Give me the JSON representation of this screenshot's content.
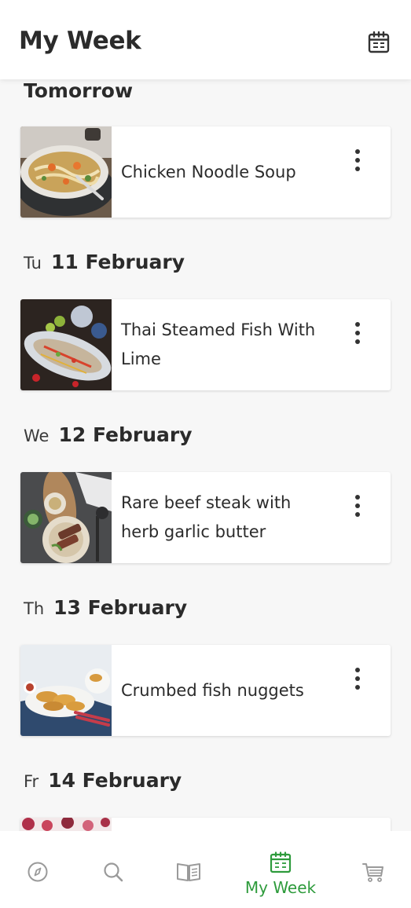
{
  "app_bar": {
    "title": "My Week",
    "calendar_icon": "calendar-icon"
  },
  "sections": [
    {
      "day": "",
      "date": "Tomorrow",
      "recipe": {
        "title": "Chicken Noodle Soup",
        "image": "chicken-noodle-soup-photo"
      }
    },
    {
      "day": "Tu",
      "date": "11 February",
      "recipe": {
        "title": "Thai Steamed Fish With Lime",
        "image": "thai-steamed-fish-photo"
      }
    },
    {
      "day": "We",
      "date": "12 February",
      "recipe": {
        "title": "Rare beef steak with herb garlic butter",
        "image": "beef-steak-photo"
      }
    },
    {
      "day": "Th",
      "date": "13 February",
      "recipe": {
        "title": "Crumbed fish nuggets",
        "image": "fish-nuggets-photo"
      }
    },
    {
      "day": "Fr",
      "date": "14 February",
      "recipe": {
        "title": "",
        "image": "partial-recipe-photo"
      }
    }
  ],
  "bottom_nav": {
    "items": [
      {
        "icon": "compass-icon",
        "label": ""
      },
      {
        "icon": "search-icon",
        "label": ""
      },
      {
        "icon": "book-icon",
        "label": ""
      },
      {
        "icon": "calendar-icon",
        "label": "My Week",
        "active": true
      },
      {
        "icon": "cart-icon",
        "label": ""
      }
    ]
  },
  "colors": {
    "accent": "#2e9b3c",
    "inactive_icon": "#9a9a9a",
    "text": "#2b2b2b",
    "background": "#f7f7f7"
  }
}
